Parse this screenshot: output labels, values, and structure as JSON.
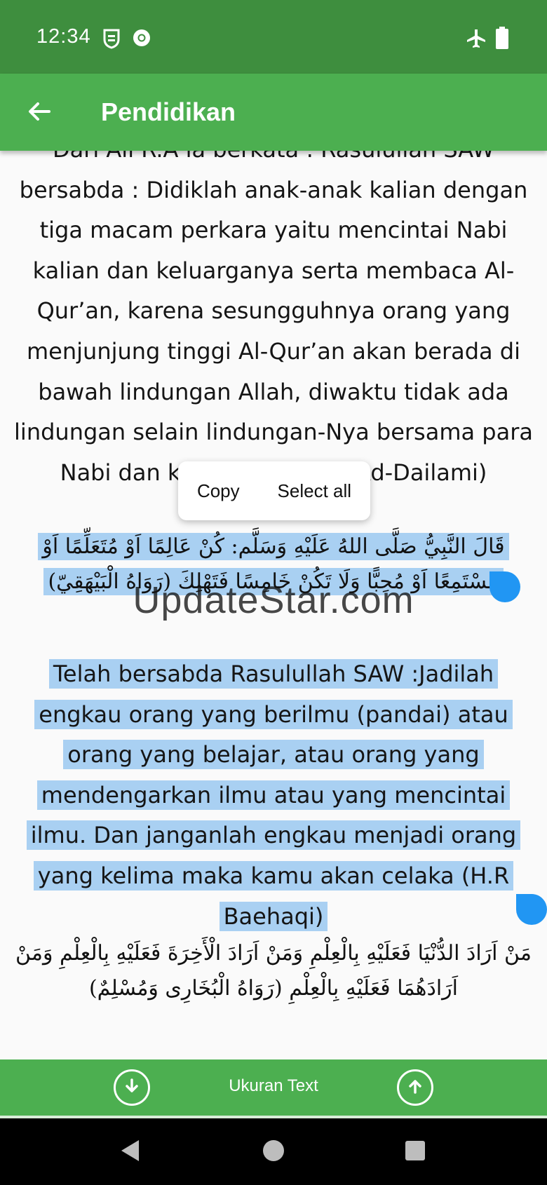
{
  "status_bar": {
    "time": "12:34",
    "icons": [
      "shield-notification-icon",
      "chrome-icon",
      "airplane-mode-icon",
      "battery-icon"
    ]
  },
  "app_bar": {
    "back_icon": "arrow-left-icon",
    "title": "Pendidikan"
  },
  "content": {
    "paragraph_1": "Dari Ali R.A ia berkata : Rasulullah SAW bersabda : Didiklah anak-anak kalian dengan tiga macam perkara yaitu mencintai Nabi kalian dan keluarganya serta membaca Al-Qur’an, karena sesungguhnya orang yang menjunjung tinggi Al-Qur’an akan berada di bawah lindungan Allah, diwaktu tidak ada lindungan selain lindungan-Nya bersama para Nabi dan kekasihnya (H.R Ad-Dailami)",
    "arabic_1": "قَالَ النَّبِيُّ صَلَّى اللهُ عَلَيْهِ وَسَلَّم: كُنْ عَالِمًا اَوْ مُتَعَلِّمًا اَوْ مُسْتَمِعًا اَوْ مُحِبًّا وَلَا تَكُنْ خَامِسًا فَتَهْلِكَ (رَوَاهُ الْبَيْهَقِيّ)",
    "paragraph_2": "Telah bersabda Rasulullah SAW :Jadilah engkau orang yang berilmu (pandai) atau orang yang belajar, atau orang yang mendengarkan ilmu atau yang mencintai ilmu. Dan janganlah engkau menjadi orang yang kelima maka kamu akan celaka (H.R Baehaqi)",
    "arabic_2": "مَنْ اَرَادَ الدُّنْيَا فَعَلَيْهِ بِالْعِلْمِ وَمَنْ اَرَادَ الْأَخِرَةَ فَعَلَيْهِ بِالْعِلْمِ وَمَنْ اَرَادَهُمَا فَعَلَيْهِ بِالْعِلْمِ (رَوَاهُ الْبُخَارِى وَمُسْلِمٌ)",
    "watermark": "UpdateStar.com"
  },
  "context_menu": {
    "copy": "Copy",
    "select_all": "Select all"
  },
  "bottom_bar": {
    "decrease_icon": "arrow-down-circle-icon",
    "label": "Ukuran Text",
    "increase_icon": "arrow-up-circle-icon"
  },
  "nav_bar": {
    "icons": [
      "back-triangle-icon",
      "home-circle-icon",
      "recents-square-icon"
    ]
  },
  "colors": {
    "status_bar": "#3e8e3e",
    "app_bar": "#4caf50",
    "selection": "#a9d0f2",
    "selection_handle": "#2196f3"
  }
}
